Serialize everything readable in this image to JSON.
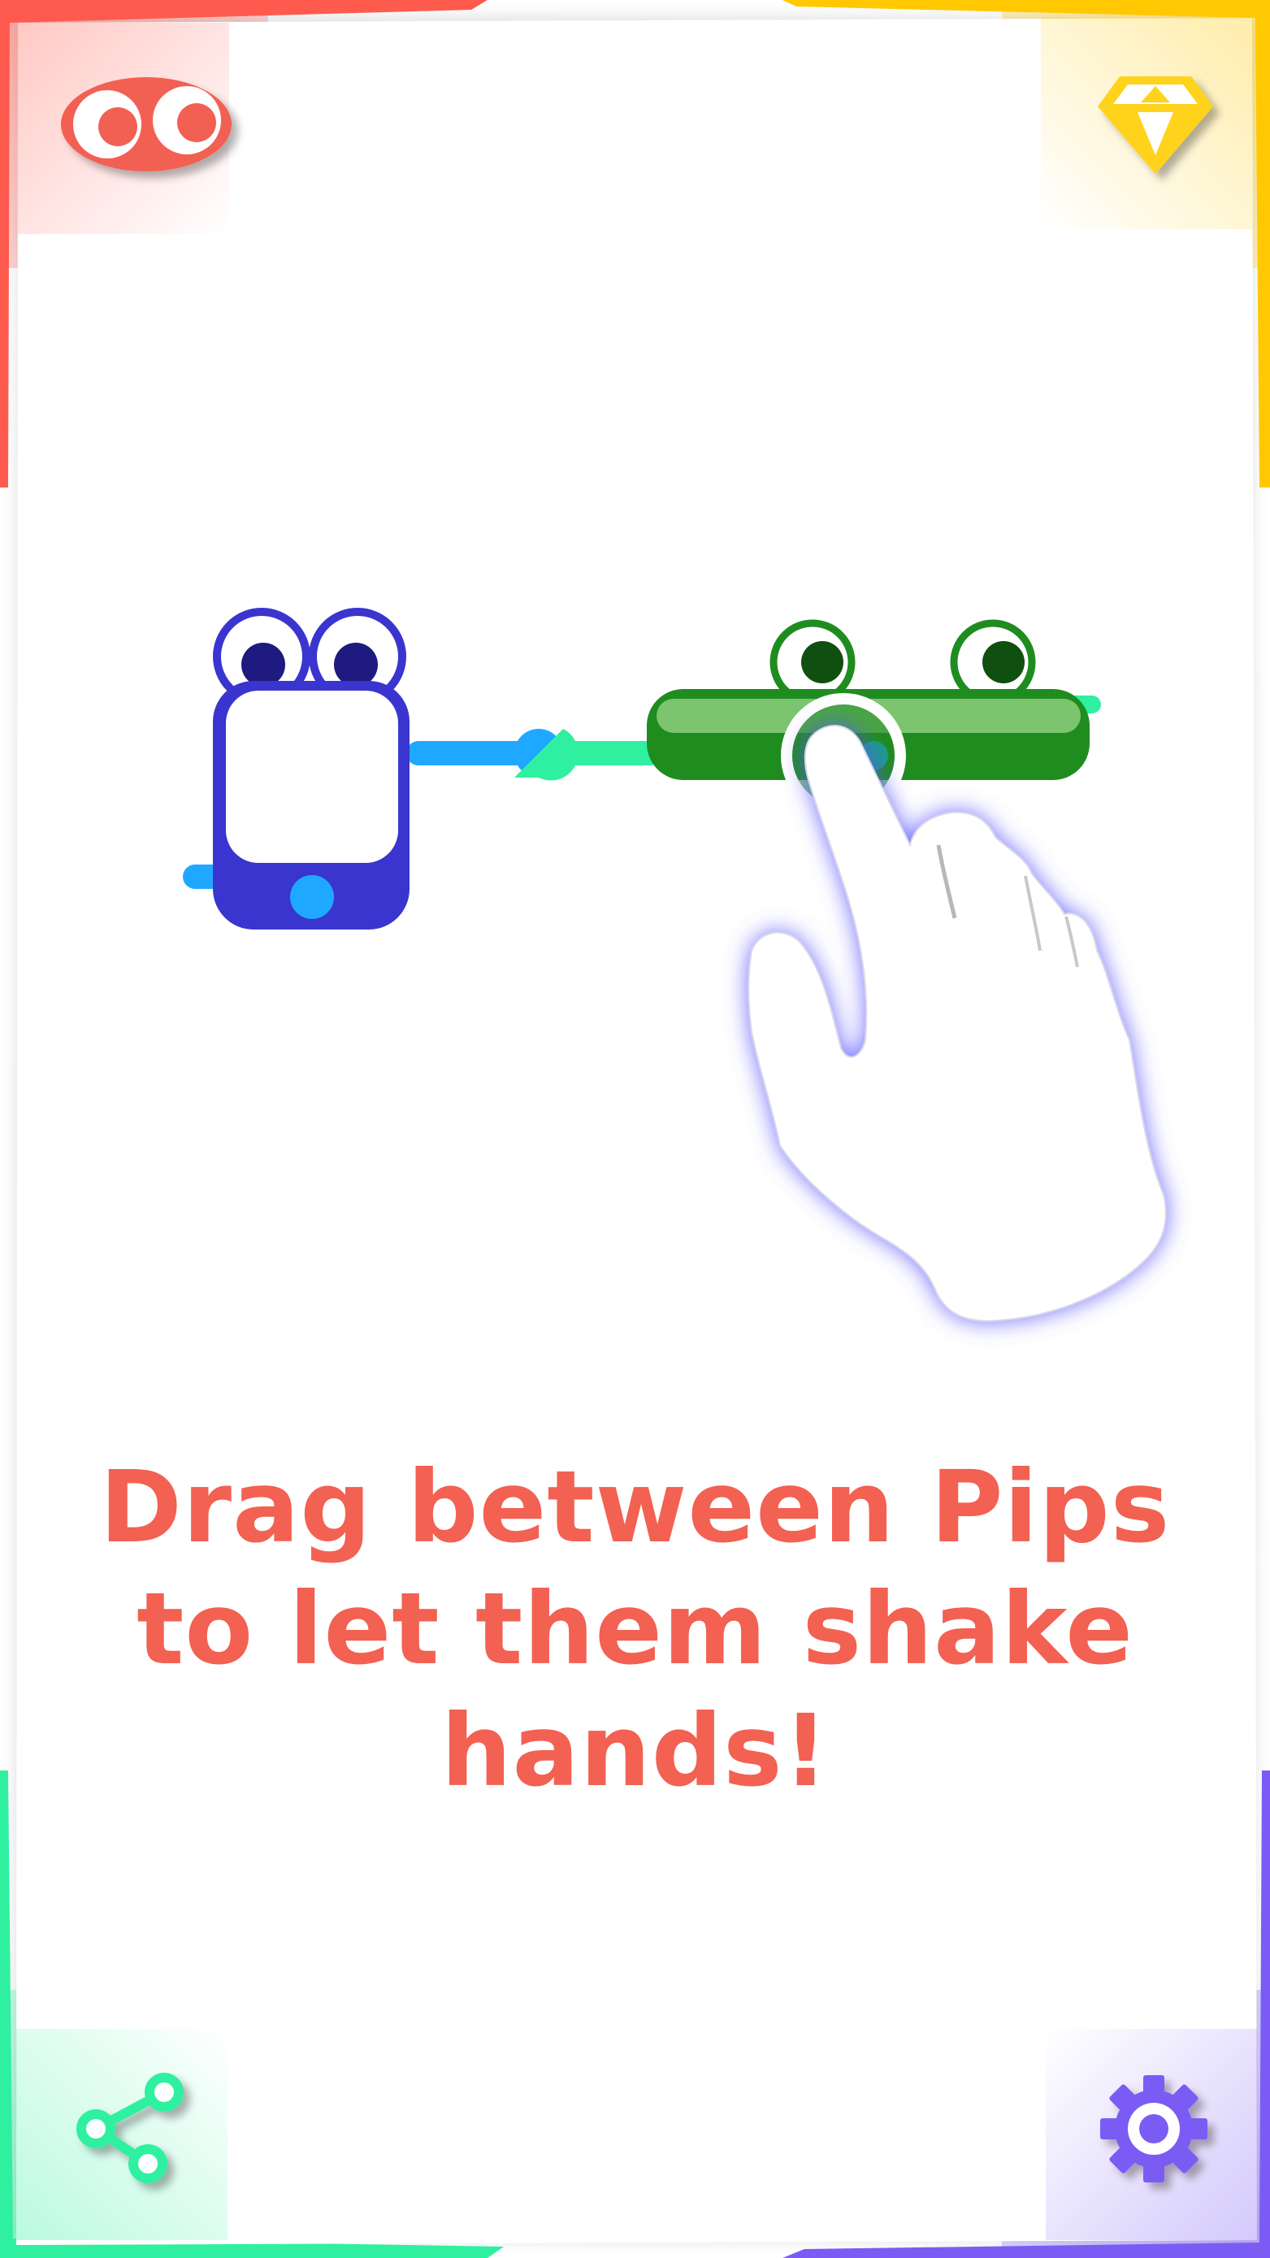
{
  "instruction": {
    "line1": "Drag between Pips",
    "line2": "to let them shake",
    "line3": "hands!"
  },
  "corner_buttons": {
    "top_left": {
      "icon": "eyes-icon",
      "color": "#f26152"
    },
    "top_right": {
      "icon": "diamond-icon",
      "color": "#ffd21f"
    },
    "bottom_left": {
      "icon": "share-icon",
      "color": "#2ff0a0"
    },
    "bottom_right": {
      "icon": "gear-icon",
      "color": "#7a5cf5"
    }
  },
  "frame_colors": {
    "top_left": "#ff5a4e",
    "top_right": "#ffc800",
    "bottom_left": "#2ff0a0",
    "bottom_right": "#7a5cf5"
  },
  "pips": [
    {
      "name": "phone-pip",
      "body_color": "#3a35cf",
      "pupil_color": "#1e1a80",
      "button_color": "#1fa8ff"
    },
    {
      "name": "bar-pip",
      "body_color": "#1f8c1f",
      "highlight_color": "#7cc46e",
      "pupil_color": "#0f4f0f"
    }
  ],
  "connector_colors": {
    "left": "#1fa8ff",
    "right": "#2ff0a0"
  },
  "hint": {
    "icon": "pointing-hand-icon",
    "glow_color": "#5a55ff"
  }
}
